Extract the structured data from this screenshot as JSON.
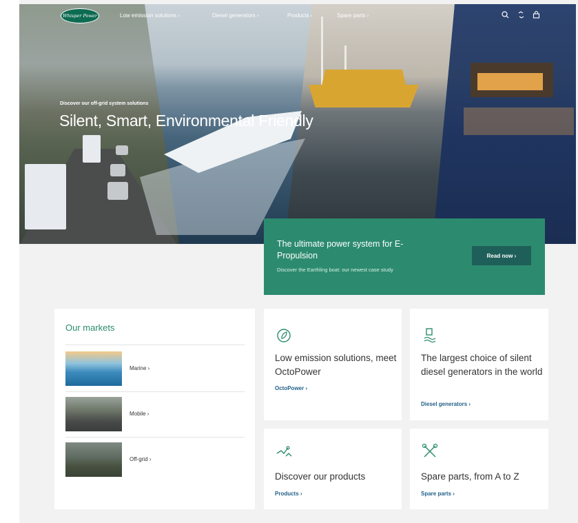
{
  "nav": {
    "logo_text": "Whisper Power",
    "items": [
      {
        "label": "Low emission solutions ›"
      },
      {
        "label": "Diesel generators ›"
      },
      {
        "label": "Products ›"
      },
      {
        "label": "Spare parts ›"
      }
    ],
    "icons": [
      "search-icon",
      "globe-icon",
      "bag-icon"
    ]
  },
  "hero": {
    "subtitle": "Discover our off-grid system solutions",
    "title": "Silent, Smart, Environmental Friendly"
  },
  "promo": {
    "title": "The ultimate power system for E-Propulsion",
    "subtitle": "Discover the Earthling boat: our newest case study",
    "button": "Read now  ›"
  },
  "markets": {
    "title": "Our markets",
    "items": [
      {
        "label": "Marine  ›"
      },
      {
        "label": "Mobile  ›"
      },
      {
        "label": "Off-grid  ›"
      }
    ]
  },
  "cards": [
    {
      "icon": "leaf-icon",
      "title": "Low emission solutions, meet OctoPower",
      "link": "OctoPower  ›"
    },
    {
      "icon": "generator-icon",
      "title": "The largest choice of silent diesel generators in the world",
      "link": "Diesel generators  ›"
    },
    {
      "icon": "products-icon",
      "title": "Discover our products",
      "link": "Products  ›"
    },
    {
      "icon": "tools-icon",
      "title": "Spare parts, from A to Z",
      "link": "Spare parts  ›"
    }
  ],
  "colors": {
    "brand_green": "#2c8b6e",
    "button_dark": "#1f5f59",
    "link_blue": "#1f5f88"
  }
}
